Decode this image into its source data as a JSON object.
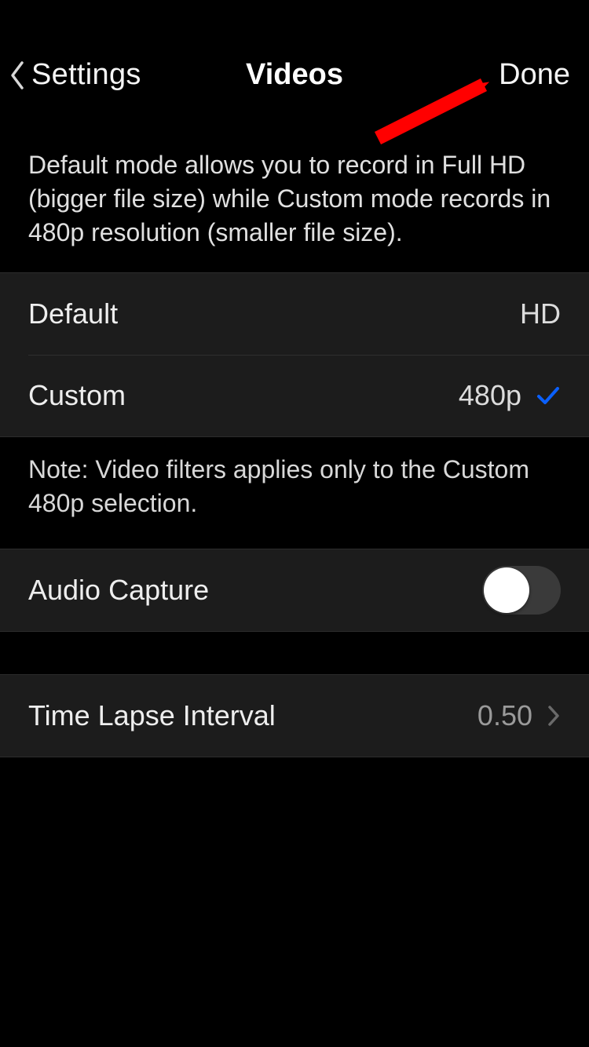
{
  "nav": {
    "back_label": "Settings",
    "title": "Videos",
    "done_label": "Done"
  },
  "description": "Default mode allows you to record in Full HD (bigger file size) while Custom mode records in 480p resolution (smaller file size).",
  "modes": {
    "default": {
      "label": "Default",
      "value": "HD",
      "selected": false
    },
    "custom": {
      "label": "Custom",
      "value": "480p",
      "selected": true
    }
  },
  "footer_note": "Note: Video filters applies only to the Custom 480p selection.",
  "audio": {
    "label": "Audio Capture",
    "enabled": false
  },
  "timelapse": {
    "label": "Time Lapse Interval",
    "value": "0.50"
  },
  "colors": {
    "accent_blue": "#0a60ff",
    "annotation_red": "#ff0000"
  }
}
